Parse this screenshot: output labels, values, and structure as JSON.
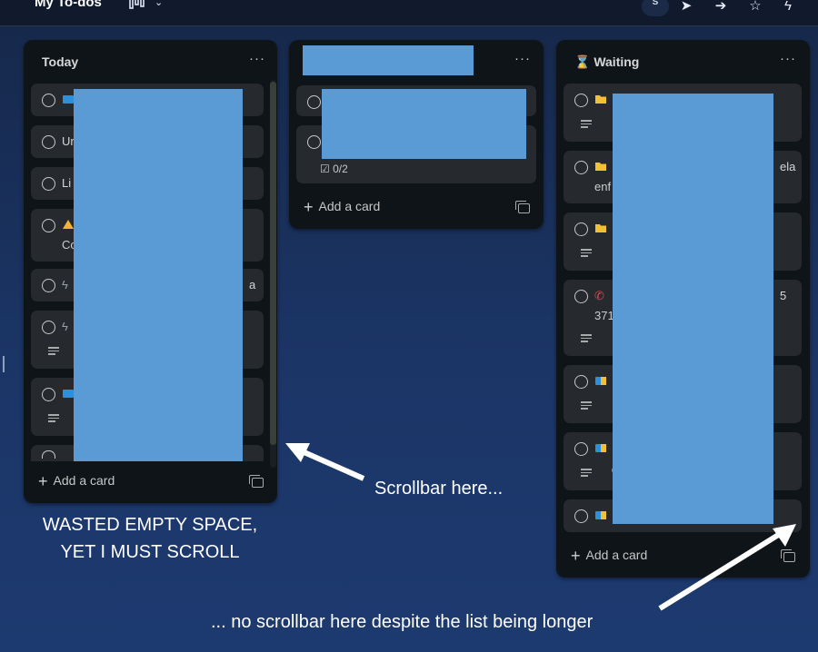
{
  "header": {
    "board_title": "My To-dos",
    "avatar_initial": "S"
  },
  "columns": [
    {
      "title": "Today",
      "more_label": "···",
      "cards": [
        {
          "text": ""
        },
        {
          "text": "Ur"
        },
        {
          "text": "Li"
        },
        {
          "text": "",
          "line2": "Co"
        },
        {
          "text": "",
          "tail": "a"
        },
        {
          "text": ""
        },
        {
          "text": ""
        },
        {
          "text": ""
        }
      ],
      "add_card_label": "Add a card"
    },
    {
      "title": "",
      "more_label": "···",
      "cards": [
        {
          "text": ""
        },
        {
          "text": "",
          "checklist": "0/2"
        }
      ],
      "add_card_label": "Add a card"
    },
    {
      "title_glyph": "⌛",
      "title": "Waiting",
      "more_label": "···",
      "cards": [
        {
          "text": ""
        },
        {
          "text": "",
          "tail": "ela",
          "line2": "enf"
        },
        {
          "text": ""
        },
        {
          "text": "",
          "tail": "5",
          "line2": "371"
        },
        {
          "text": ""
        },
        {
          "text": ""
        },
        {
          "text": ""
        }
      ],
      "add_card_label": "Add a card"
    }
  ],
  "annotations": {
    "wasted_space": "WASTED EMPTY SPACE, YET I MUST SCROLL",
    "scrollbar_here": "Scrollbar here...",
    "no_scrollbar": "... no scrollbar here despite the list being longer"
  },
  "colors": {
    "redaction": "#5b9bd5",
    "card_bg": "#262a2f",
    "column_bg": "#0f1418",
    "folder_icon": "#f2c037",
    "phone_icon": "#e04848",
    "bag_icon": "#2f8fd8",
    "warning_icon": "#f2b233"
  },
  "icons": {
    "card_state": "circle-checkbox-icon",
    "notes": "notes-lines-icon",
    "templates": "card-template-icon"
  }
}
